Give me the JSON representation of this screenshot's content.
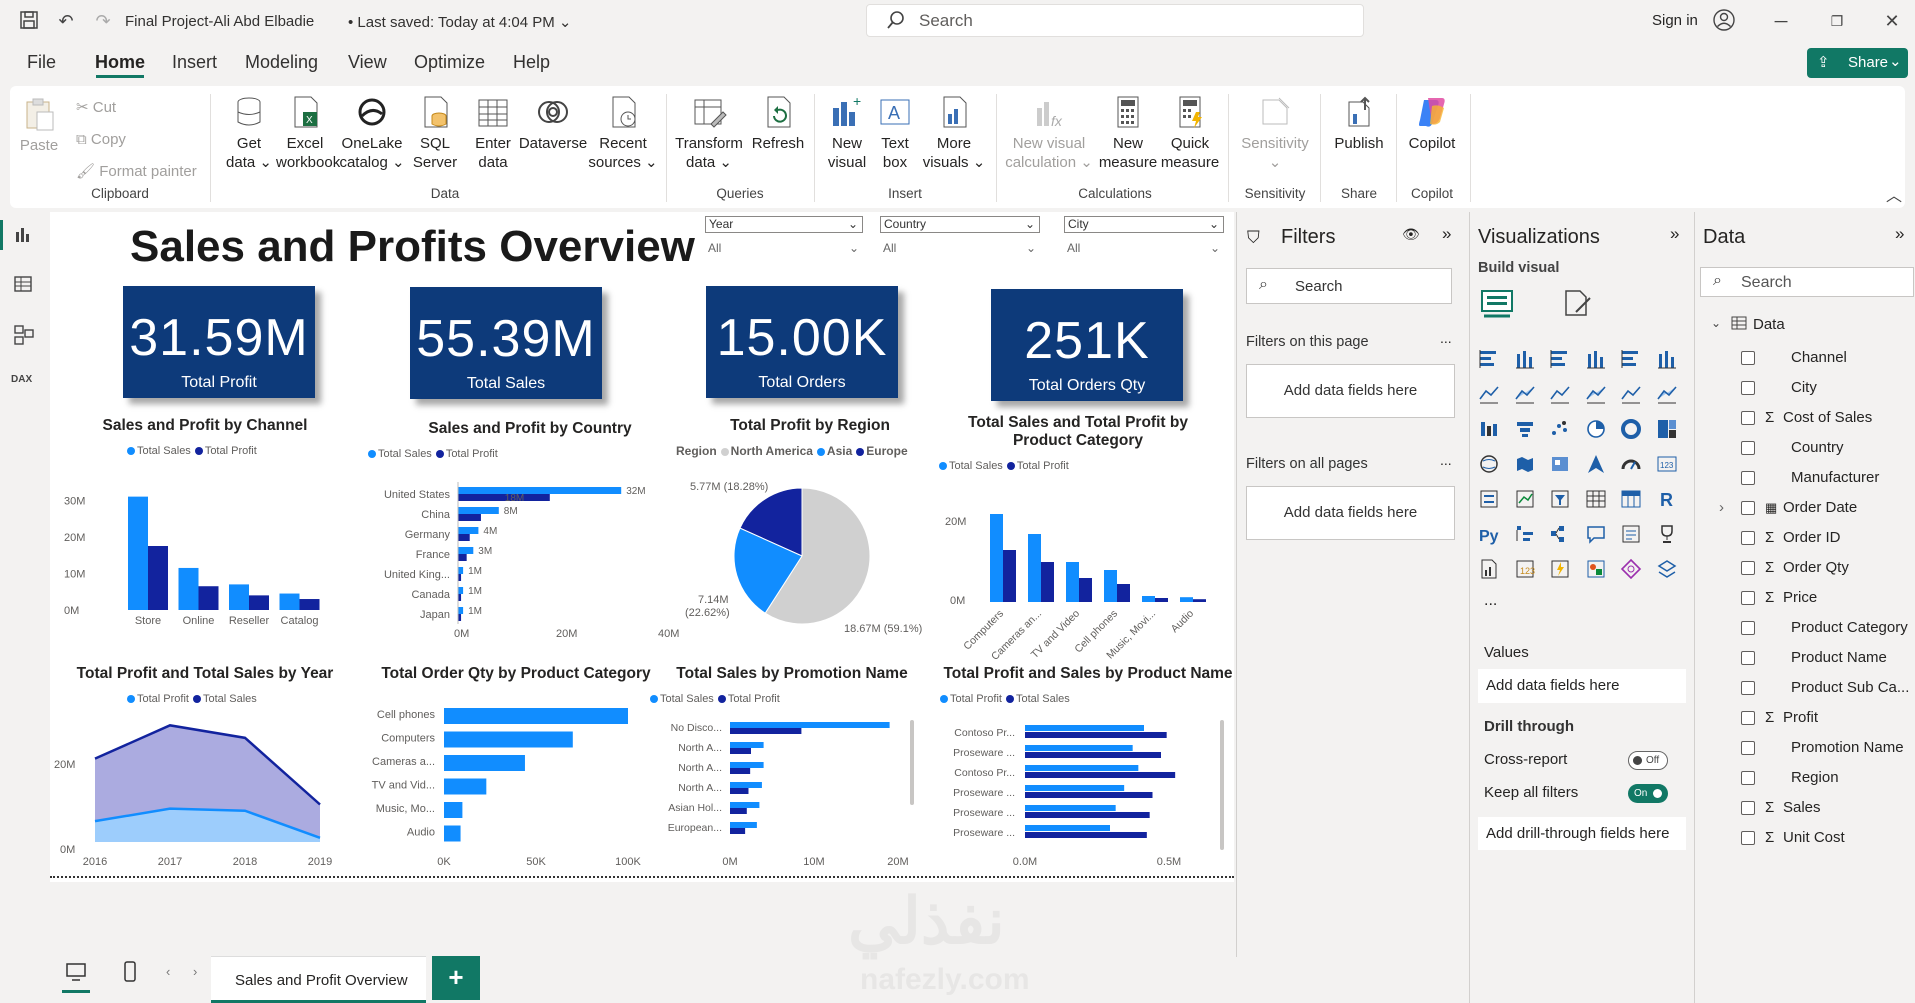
{
  "titlebar": {
    "title": "Final Project-Ali Abd Elbadie",
    "saved": "Last saved: Today at 4:04 PM",
    "search_placeholder": "Search",
    "signin": "Sign in"
  },
  "menu": {
    "items": [
      "File",
      "Home",
      "Insert",
      "Modeling",
      "View",
      "Optimize",
      "Help"
    ],
    "share": "Share"
  },
  "ribbon": {
    "clipboard": {
      "paste": "Paste",
      "cut": "Cut",
      "copy": "Copy",
      "format_painter": "Format painter",
      "label": "Clipboard"
    },
    "data": {
      "get_data": [
        "Get",
        "data ⌄"
      ],
      "excel": [
        "Excel",
        "workbook"
      ],
      "onelake": [
        "OneLake",
        "catalog ⌄"
      ],
      "sql": [
        "SQL",
        "Server"
      ],
      "enter": [
        "Enter",
        "data"
      ],
      "dataverse": [
        "Dataverse"
      ],
      "recent": [
        "Recent",
        "sources ⌄"
      ],
      "label": "Data"
    },
    "queries": {
      "transform": [
        "Transform",
        "data ⌄"
      ],
      "refresh": [
        "Refresh"
      ],
      "label": "Queries"
    },
    "insert": {
      "new_visual": [
        "New",
        "visual"
      ],
      "text_box": [
        "Text",
        "box"
      ],
      "more_visuals": [
        "More",
        "visuals ⌄"
      ],
      "label": "Insert"
    },
    "calculations": {
      "new_visual_calc": [
        "New visual",
        "calculation ⌄"
      ],
      "new_measure": [
        "New",
        "measure"
      ],
      "quick_measure": [
        "Quick",
        "measure"
      ],
      "label": "Calculations"
    },
    "sensitivity": {
      "btn": [
        "Sensitivity",
        "⌄"
      ],
      "label": "Sensitivity"
    },
    "share": {
      "btn": [
        "Publish"
      ],
      "label": "Share"
    },
    "copilot": {
      "btn": [
        "Copilot"
      ],
      "label": "Copilot"
    }
  },
  "report": {
    "title": "Sales and Profits Overview",
    "slicers": [
      {
        "field": "Year",
        "value": "All"
      },
      {
        "field": "Country",
        "value": "All"
      },
      {
        "field": "City",
        "value": "All"
      }
    ],
    "kpis": [
      {
        "value": "31.59M",
        "label": "Total Profit"
      },
      {
        "value": "55.39M",
        "label": "Total Sales"
      },
      {
        "value": "15.00K",
        "label": "Total Orders"
      },
      {
        "value": "251K",
        "label": "Total Orders Qty"
      }
    ],
    "colors": {
      "light": "#118dff",
      "dark": "#12239e",
      "grey": "#d0d0d0",
      "kpi": "#0d3a7a"
    }
  },
  "chart_data": [
    {
      "type": "bar",
      "title": "Sales and Profit by Channel",
      "legend": [
        "Total Sales",
        "Total Profit"
      ],
      "categories": [
        "Store",
        "Online",
        "Reseller",
        "Catalog"
      ],
      "series": [
        {
          "name": "Total Sales",
          "values": [
            31,
            11.5,
            7,
            4.5
          ]
        },
        {
          "name": "Total Profit",
          "values": [
            17.5,
            6.5,
            4,
            3
          ]
        }
      ],
      "yticks": [
        "30M",
        "20M",
        "10M",
        "0M"
      ],
      "ylim": [
        0,
        35
      ]
    },
    {
      "type": "bar",
      "orientation": "horizontal",
      "title": "Sales and Profit by Country",
      "legend": [
        "Total Sales",
        "Total Profit"
      ],
      "categories": [
        "United States",
        "China",
        "Germany",
        "France",
        "United King...",
        "Canada",
        "Japan"
      ],
      "series": [
        {
          "name": "Total Sales",
          "values": [
            32,
            8,
            4,
            3,
            1,
            1,
            1
          ],
          "labels": [
            "32M",
            "8M",
            "4M",
            "3M",
            "1M",
            "1M",
            "1M"
          ]
        },
        {
          "name": "Total Profit",
          "values": [
            18,
            4.5,
            2.3,
            1.7,
            0.6,
            0.6,
            0.6
          ],
          "labels": [
            "18M",
            "",
            "",
            "",
            "",
            "",
            ""
          ]
        }
      ],
      "xticks": [
        "0M",
        "20M",
        "40M"
      ],
      "xlim": [
        0,
        40
      ]
    },
    {
      "type": "pie",
      "title": "Total Profit by Region",
      "legend_title": "Region",
      "legend": [
        "North America",
        "Asia",
        "Europe"
      ],
      "slices": [
        {
          "name": "North America",
          "value": 59.1,
          "label": "18.67M (59.1%)"
        },
        {
          "name": "Asia",
          "value": 22.62,
          "label": "7.14M (22.62%)"
        },
        {
          "name": "Europe",
          "value": 18.28,
          "label": "5.77M (18.28%)"
        }
      ]
    },
    {
      "type": "bar",
      "title": "Total Sales and Total Profit by Product Category",
      "legend": [
        "Total Sales",
        "Total Profit"
      ],
      "categories": [
        "Computers",
        "Cameras an...",
        "TV and Video",
        "Cell phones",
        "Music, Movi...",
        "Audio"
      ],
      "series": [
        {
          "name": "Total Sales",
          "values": [
            22,
            17,
            10,
            8,
            1.5,
            1.2
          ]
        },
        {
          "name": "Total Profit",
          "values": [
            13,
            10,
            6,
            4.5,
            1,
            0.7
          ]
        }
      ],
      "yticks": [
        "20M",
        "0M"
      ],
      "ylim": [
        0,
        25
      ]
    },
    {
      "type": "area",
      "title": "Total Profit and Total Sales by Year",
      "legend": [
        "Total Profit",
        "Total Sales"
      ],
      "categories": [
        "2016",
        "2017",
        "2018",
        "2019"
      ],
      "series": [
        {
          "name": "Total Profit",
          "values": [
            5,
            8,
            7.5,
            1
          ]
        },
        {
          "name": "Total Sales",
          "values": [
            20,
            28,
            25,
            9
          ]
        }
      ],
      "yticks": [
        "20M",
        "0M"
      ],
      "ylim": [
        0,
        30
      ]
    },
    {
      "type": "bar",
      "orientation": "horizontal",
      "title": "Total Order Qty by Product Category",
      "categories": [
        "Cell phones",
        "Computers",
        "Cameras a...",
        "TV and Vid...",
        "Music, Mo...",
        "Audio"
      ],
      "values": [
        100,
        70,
        44,
        23,
        10,
        9
      ],
      "xticks": [
        "0K",
        "50K",
        "100K"
      ],
      "xlim": [
        0,
        100
      ]
    },
    {
      "type": "bar",
      "orientation": "horizontal",
      "title": "Total Sales by Promotion Name",
      "legend": [
        "Total Sales",
        "Total Profit"
      ],
      "categories": [
        "No Disco...",
        "North A...",
        "North A...",
        "North A...",
        "Asian Hol...",
        "European..."
      ],
      "series": [
        {
          "name": "Total Sales",
          "values": [
            19,
            4,
            4,
            3.8,
            3.5,
            3.2
          ]
        },
        {
          "name": "Total Profit",
          "values": [
            8.5,
            2.5,
            2.4,
            2.2,
            2.0,
            1.8
          ]
        }
      ],
      "xticks": [
        "0M",
        "10M",
        "20M"
      ],
      "xlim": [
        0,
        20
      ]
    },
    {
      "type": "bar",
      "orientation": "horizontal",
      "title": "Total Profit and Sales by Product Name",
      "legend": [
        "Total Profit",
        "Total  Sales"
      ],
      "categories": [
        "Contoso Pr...",
        "Proseware ...",
        "Contoso Pr...",
        "Proseware ...",
        "Proseware ...",
        "Proseware ..."
      ],
      "series": [
        {
          "name": "Total Profit",
          "values": [
            0.42,
            0.38,
            0.4,
            0.35,
            0.32,
            0.3
          ]
        },
        {
          "name": "Total  Sales",
          "values": [
            0.5,
            0.48,
            0.53,
            0.45,
            0.44,
            0.43
          ]
        }
      ],
      "xticks": [
        "0.0M",
        "0.5M"
      ],
      "xlim": [
        0,
        0.6
      ]
    }
  ],
  "pagetabs": {
    "tab": "Sales and Profit Overview",
    "add": "+"
  },
  "filters": {
    "title": "Filters",
    "search": "Search",
    "on_page": "Filters on this page",
    "all_pages": "Filters on all pages",
    "add": "Add data fields here",
    "more": "..."
  },
  "viz": {
    "title": "Visualizations",
    "build": "Build visual",
    "values": "Values",
    "add": "Add data fields here",
    "drill": "Drill through",
    "cross": "Cross-report",
    "cross_state": "Off",
    "keep": "Keep all filters",
    "keep_state": "On",
    "drill_add": "Add drill-through fields here",
    "more": "..."
  },
  "data": {
    "title": "Data",
    "search": "Search",
    "table": "Data",
    "fields": [
      {
        "name": "Channel",
        "sigma": false,
        "expand": false
      },
      {
        "name": "City",
        "sigma": false,
        "expand": false
      },
      {
        "name": "Cost of Sales",
        "sigma": true,
        "expand": false
      },
      {
        "name": "Country",
        "sigma": false,
        "expand": false
      },
      {
        "name": "Manufacturer",
        "sigma": false,
        "expand": false
      },
      {
        "name": "Order Date",
        "sigma": false,
        "expand": true
      },
      {
        "name": "Order ID",
        "sigma": true,
        "expand": false
      },
      {
        "name": "Order Qty",
        "sigma": true,
        "expand": false
      },
      {
        "name": "Price",
        "sigma": true,
        "expand": false
      },
      {
        "name": "Product Category",
        "sigma": false,
        "expand": false
      },
      {
        "name": "Product Name",
        "sigma": false,
        "expand": false
      },
      {
        "name": "Product Sub Ca...",
        "sigma": false,
        "expand": false
      },
      {
        "name": "Profit",
        "sigma": true,
        "expand": false
      },
      {
        "name": "Promotion Name",
        "sigma": false,
        "expand": false
      },
      {
        "name": "Region",
        "sigma": false,
        "expand": false
      },
      {
        "name": "Sales",
        "sigma": true,
        "expand": false
      },
      {
        "name": "Unit Cost",
        "sigma": true,
        "expand": false
      }
    ]
  },
  "watermark": {
    "arabic": "نفذلي",
    "latin": "nafezly.com"
  }
}
